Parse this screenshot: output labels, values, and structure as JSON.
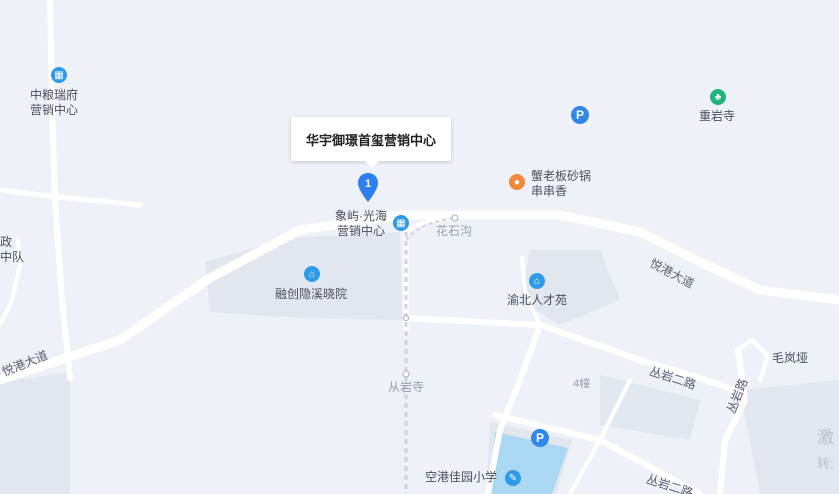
{
  "map": {
    "selected_place": {
      "number": "1",
      "name": "华宇御璟首玺营销中心"
    },
    "poi_labels": [
      {
        "id": "zhongliang",
        "lines": [
          "中粮瑞府",
          "营销中心"
        ],
        "icon": "building-icon"
      },
      {
        "id": "chongyan-temple",
        "lines": [
          "重岩寺"
        ],
        "icon": "temple-icon"
      },
      {
        "id": "xielaoban",
        "lines": [
          "蟹老板砂锅",
          "串串香"
        ],
        "icon": "food-icon"
      },
      {
        "id": "xiangyu",
        "lines": [
          "象屿·光海",
          "营销中心"
        ],
        "icon": "building-icon"
      },
      {
        "id": "rongchuang",
        "lines": [
          "融创隐溪晓院"
        ],
        "icon": "residence-icon"
      },
      {
        "id": "yubei-rencai",
        "lines": [
          "渝北人才苑"
        ],
        "icon": "residence-icon"
      },
      {
        "id": "konggang-school",
        "lines": [
          "空港佳园小学"
        ],
        "icon": "school-icon"
      },
      {
        "id": "zhengzhi",
        "lines": [
          "政",
          "中队"
        ],
        "icon": ""
      }
    ],
    "road_labels": [
      {
        "id": "yuegang-1",
        "text": "悦港大道"
      },
      {
        "id": "yuegang-2",
        "text": "悦港大道"
      },
      {
        "id": "congyan-2",
        "text": "丛岩二路"
      },
      {
        "id": "congyan-2b",
        "text": "丛岩二路"
      },
      {
        "id": "congyan-v",
        "text": "丛岩路"
      }
    ],
    "place_labels": [
      {
        "id": "huashigou",
        "text": "花石沟"
      },
      {
        "id": "congyan-temple-station",
        "text": "从岩寺"
      },
      {
        "id": "maolan",
        "text": "毛岚垭"
      },
      {
        "id": "building-4",
        "text": "4幢"
      },
      {
        "id": "partial-ji",
        "text": "激"
      },
      {
        "id": "partial-zhuan",
        "text": "转;"
      }
    ],
    "parking_label": "P",
    "colors": {
      "background": "#eef1f8",
      "road": "#ffffff",
      "block": "#e0e4ee",
      "water": "#aad8f2",
      "marker": "#2f7ef0"
    }
  }
}
